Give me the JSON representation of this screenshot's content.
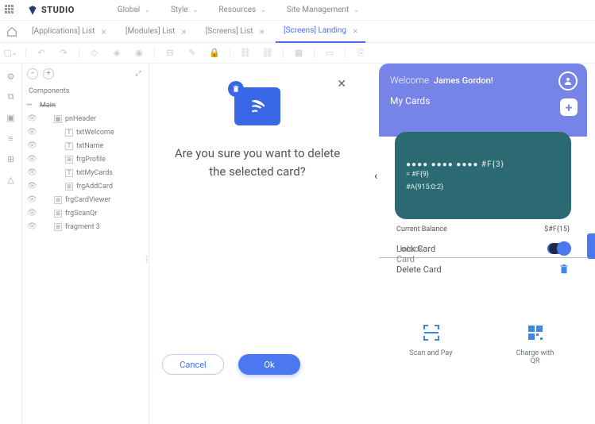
{
  "app": {
    "name": "STUDIO"
  },
  "topmenu": [
    {
      "label": "Global"
    },
    {
      "label": "Style"
    },
    {
      "label": "Resources"
    },
    {
      "label": "Site Management"
    }
  ],
  "tabs": [
    {
      "label": "[Applications] List",
      "active": false
    },
    {
      "label": "[Modules] List",
      "active": false
    },
    {
      "label": "[Screens] List",
      "active": false
    },
    {
      "label": "[Screens] Landing",
      "active": true
    }
  ],
  "tree": {
    "title": "Components",
    "root": "Main",
    "nodes": [
      {
        "indent": 1,
        "icon": "▦",
        "label": "pnHeader"
      },
      {
        "indent": 2,
        "icon": "T",
        "label": "txtWelcome"
      },
      {
        "indent": 2,
        "icon": "T",
        "label": "txtName"
      },
      {
        "indent": 2,
        "icon": "⊞",
        "label": "frgProfile"
      },
      {
        "indent": 2,
        "icon": "T",
        "label": "txtMyCards"
      },
      {
        "indent": 2,
        "icon": "⊞",
        "label": "frgAddCard"
      },
      {
        "indent": 1,
        "icon": "⊞",
        "label": "frgCardViewer"
      },
      {
        "indent": 1,
        "icon": "⊞",
        "label": "frgScanQr"
      },
      {
        "indent": 1,
        "icon": "⊞",
        "label": "fragment 3"
      }
    ]
  },
  "dialog": {
    "text": "Are you sure you want to delete the selected card?",
    "cancel": "Cancel",
    "ok": "Ok"
  },
  "preview": {
    "welcome_prefix": "Welcome",
    "username": "James Gordon!",
    "mycards": "My Cards",
    "card": {
      "mask": "●●●● ●●●● ●●●●  #F{3}",
      "line2": "= #F{9}",
      "line3": "#A{915:0:2}"
    },
    "balance_label": "Current Balance",
    "balance_value": "$#F{15}",
    "action_lock": "Lock Card",
    "action_unlock_overlay": "Unlock Card",
    "action_delete": "Delete Card",
    "quick": [
      {
        "label": "Scan and Pay"
      },
      {
        "label": "Charge with QR"
      }
    ]
  }
}
